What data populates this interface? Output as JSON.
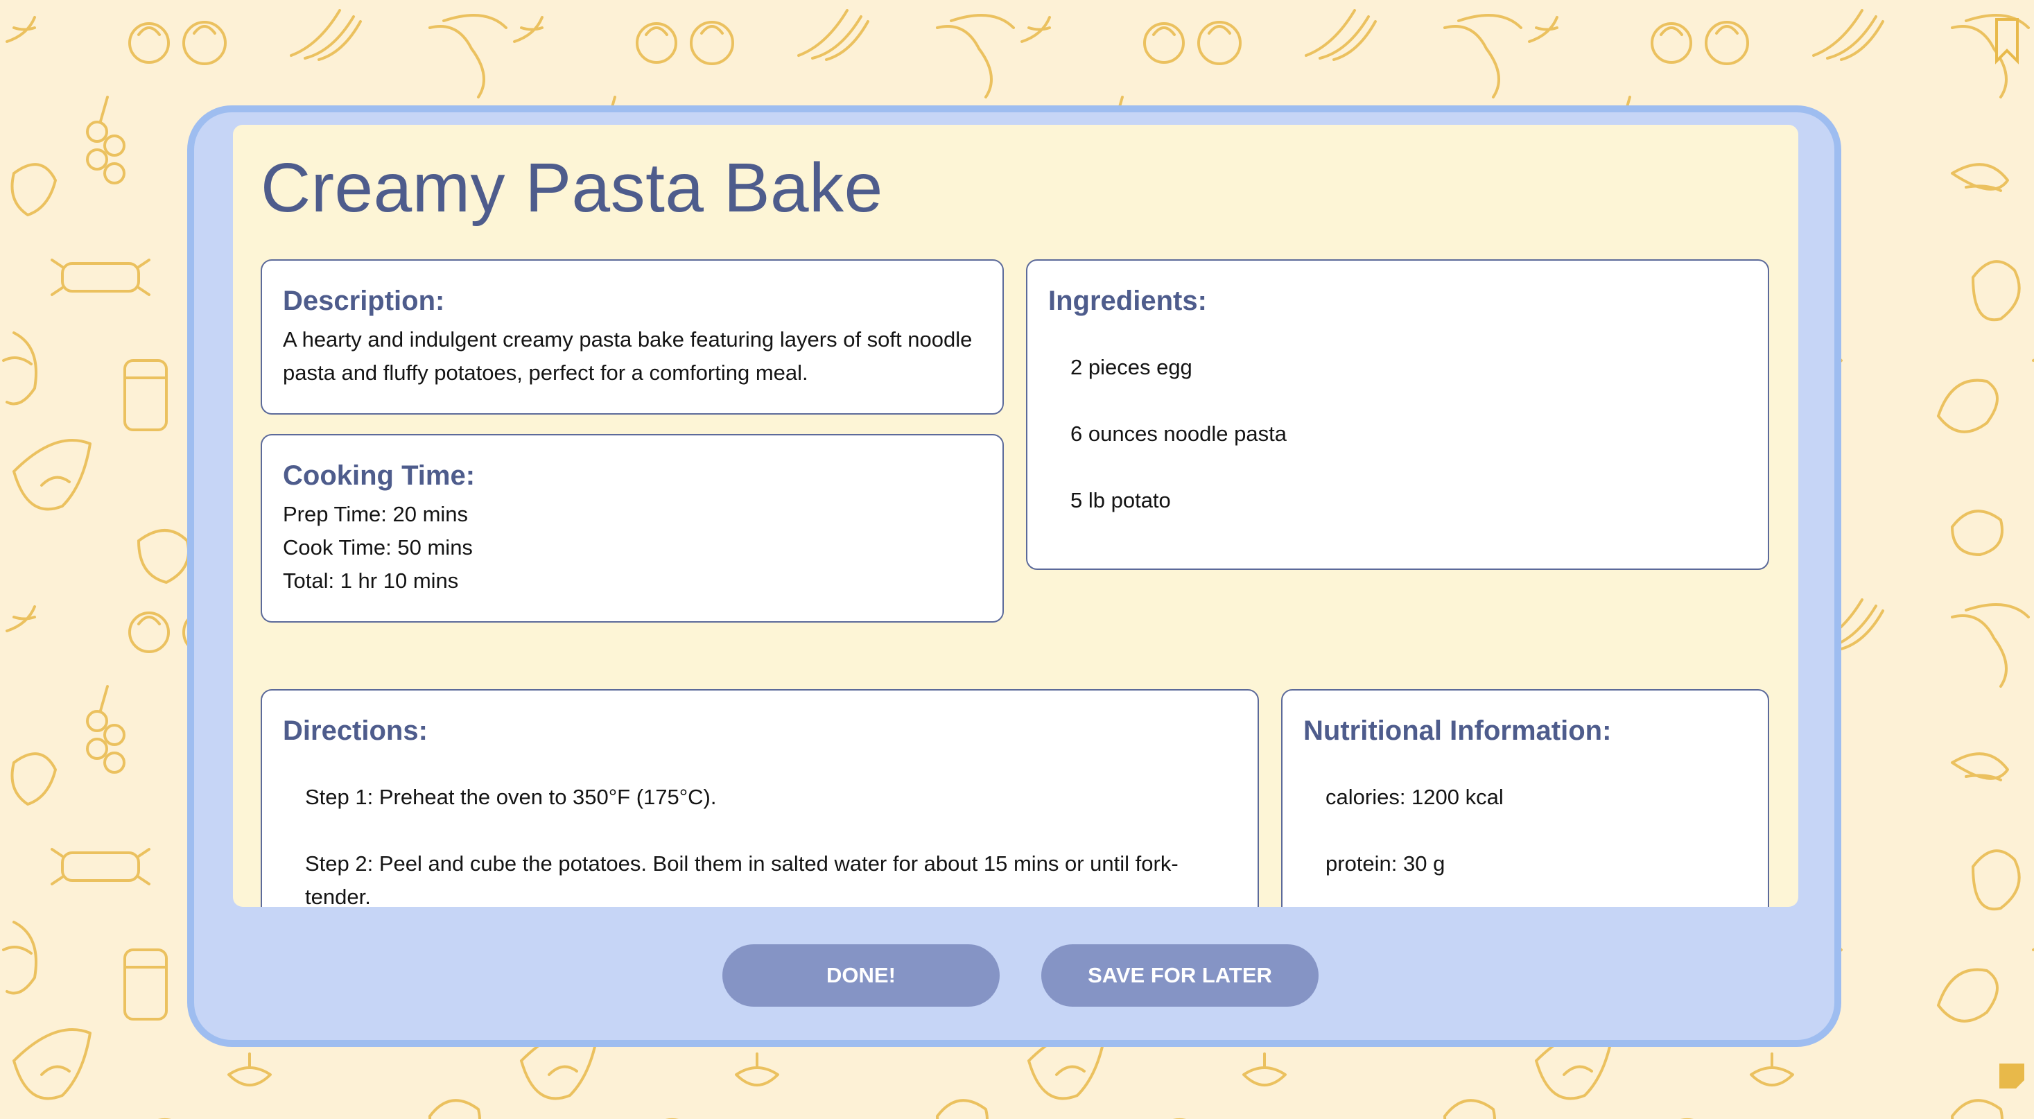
{
  "recipe": {
    "title": "Creamy Pasta Bake",
    "description": {
      "heading": "Description:",
      "text": "A hearty and indulgent creamy pasta bake featuring layers of soft noodle pasta and fluffy potatoes, perfect for a comforting meal."
    },
    "cooking_time": {
      "heading": "Cooking Time:",
      "prep": "Prep Time: 20 mins",
      "cook": "Cook Time: 50 mins",
      "total": "Total: 1 hr 10 mins"
    },
    "ingredients": {
      "heading": "Ingredients:",
      "items": [
        "2 pieces egg",
        "6 ounces noodle pasta",
        "5 lb potato"
      ]
    },
    "directions": {
      "heading": "Directions:",
      "steps": [
        "Step 1: Preheat the oven to 350°F (175°C).",
        "Step 2: Peel and cube the potatoes. Boil them in salted water for about 15 mins or until fork-tender."
      ]
    },
    "nutrition": {
      "heading": "Nutritional Information:",
      "items": [
        "calories: 1200 kcal",
        "protein: 30 g"
      ]
    }
  },
  "buttons": {
    "done": "DONE!",
    "save": "SAVE FOR LATER"
  },
  "colors": {
    "background": "#fdf1d6",
    "pattern": "#e8b94a",
    "card": "#c6d5f6",
    "card_border": "#9ebdf0",
    "content": "#fdf5d6",
    "heading": "#4e5c8c",
    "button": "#8594c5"
  },
  "icons": [
    "food-doodle-pattern",
    "bookmark-flag-icon",
    "corner-tab-icon"
  ]
}
